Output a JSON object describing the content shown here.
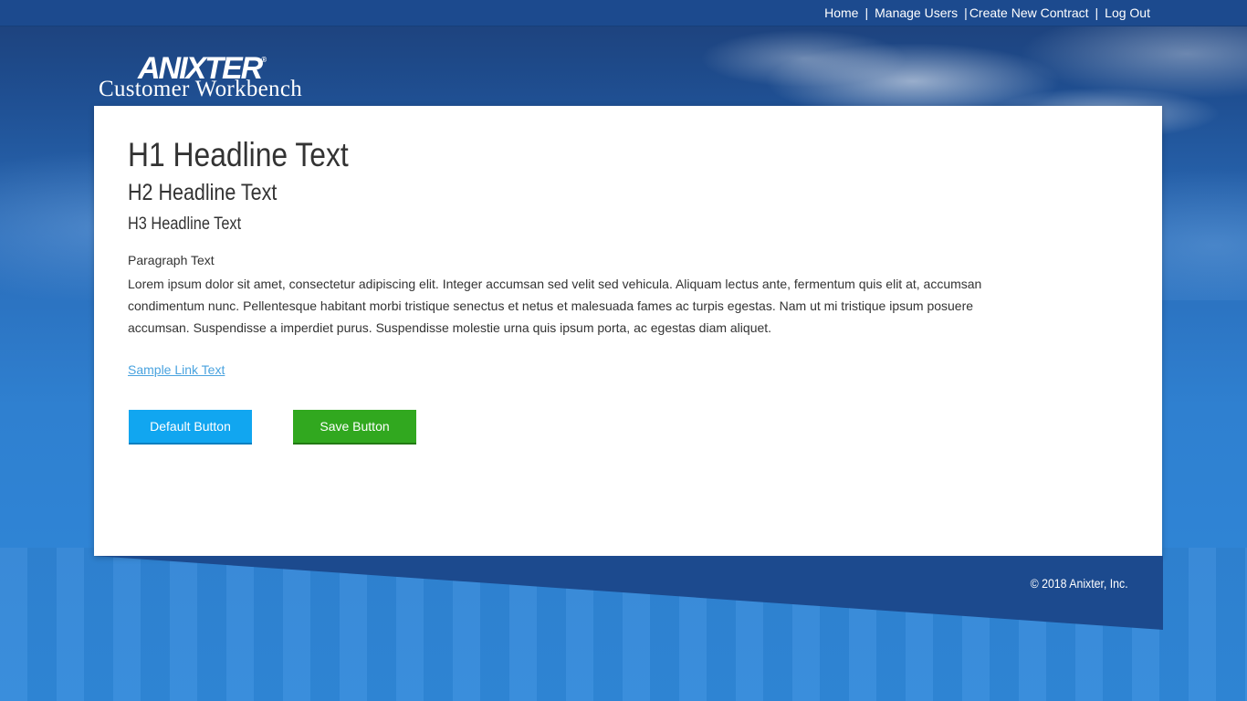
{
  "nav": {
    "items": [
      {
        "label": "Home"
      },
      {
        "label": "Manage Users"
      },
      {
        "label": "Create New Contract"
      },
      {
        "label": "Log Out"
      }
    ],
    "separator": "|"
  },
  "logo": {
    "brand": "ANIXTER",
    "registered": "®",
    "product": "Customer Workbench"
  },
  "content": {
    "h1": "H1 Headline Text",
    "h2": "H2 Headline Text",
    "h3": "H3 Headline Text",
    "paragraph_title": "Paragraph Text",
    "paragraph": "Lorem ipsum dolor sit amet, consectetur adipiscing elit. Integer accumsan sed velit sed vehicula. Aliquam lectus ante, fermentum quis elit at, accumsan condimentum nunc. Pellentesque habitant morbi tristique senectus et netus et malesuada fames ac turpis egestas. Nam ut mi tristique ipsum posuere accumsan. Suspendisse a imperdiet purus. Suspendisse molestie urna quis ipsum porta, ac egestas diam aliquet.",
    "link": "Sample Link Text"
  },
  "buttons": {
    "default_label": "Default Button",
    "save_label": "Save Button"
  },
  "footer": {
    "copyright": "© 2018 Anixter, Inc."
  },
  "colors": {
    "nav_bar": "#1c4a8e",
    "link": "#4aa3df",
    "default_button": "#11a6f0",
    "save_button": "#31a81f",
    "text": "#333333"
  }
}
